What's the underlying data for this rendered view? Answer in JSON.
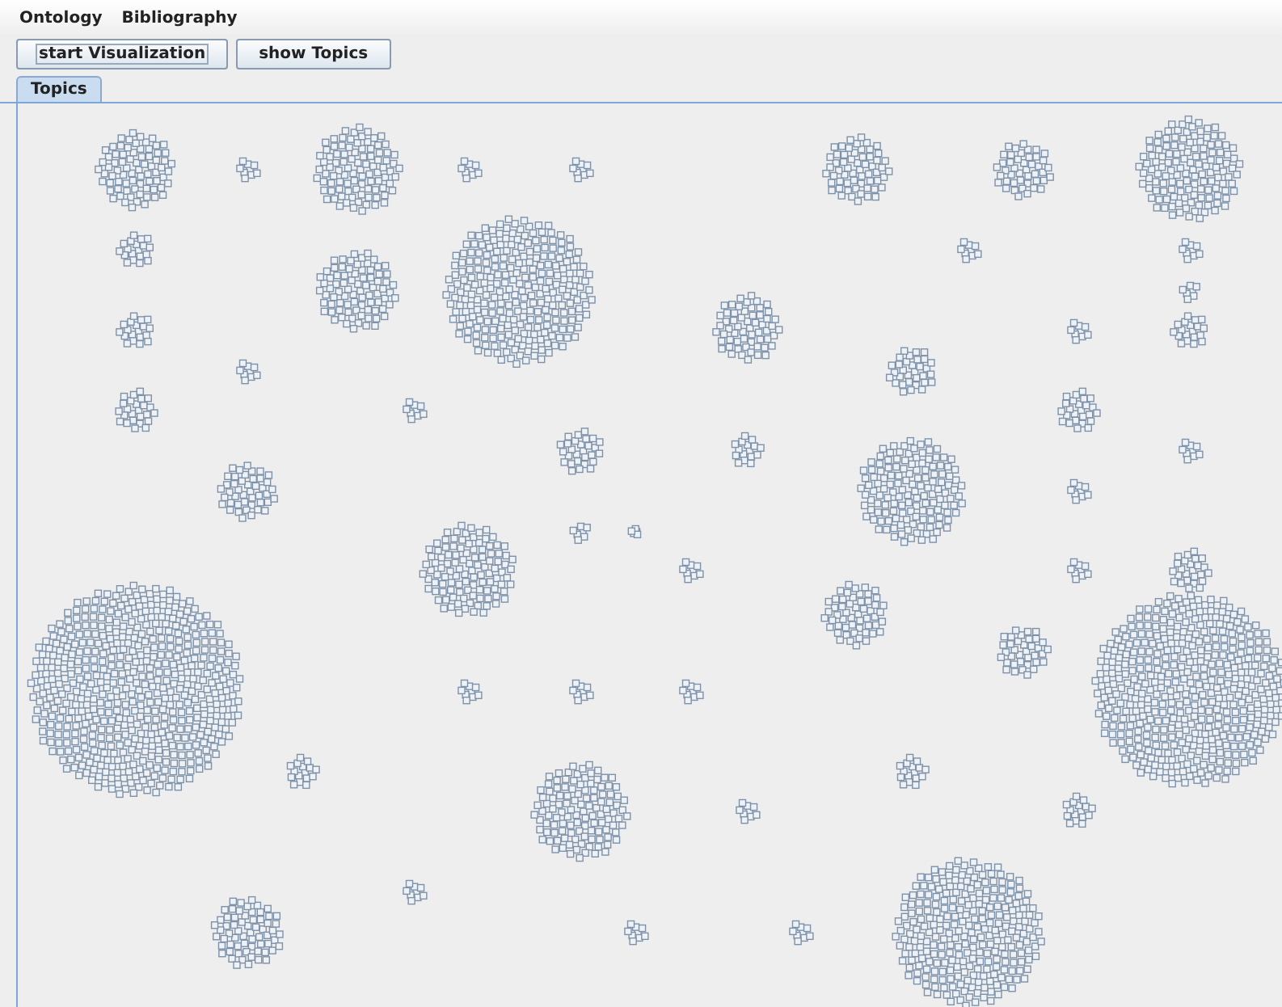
{
  "menu": [
    "Ontology",
    "Bibliography"
  ],
  "buttons": [
    {
      "label": "start Visualization",
      "focused": true
    },
    {
      "label": "show Topics",
      "focused": false
    }
  ],
  "tabs": [
    {
      "label": "Topics",
      "selected": true
    }
  ],
  "canvas": {
    "kind": "topic-clusters"
  }
}
